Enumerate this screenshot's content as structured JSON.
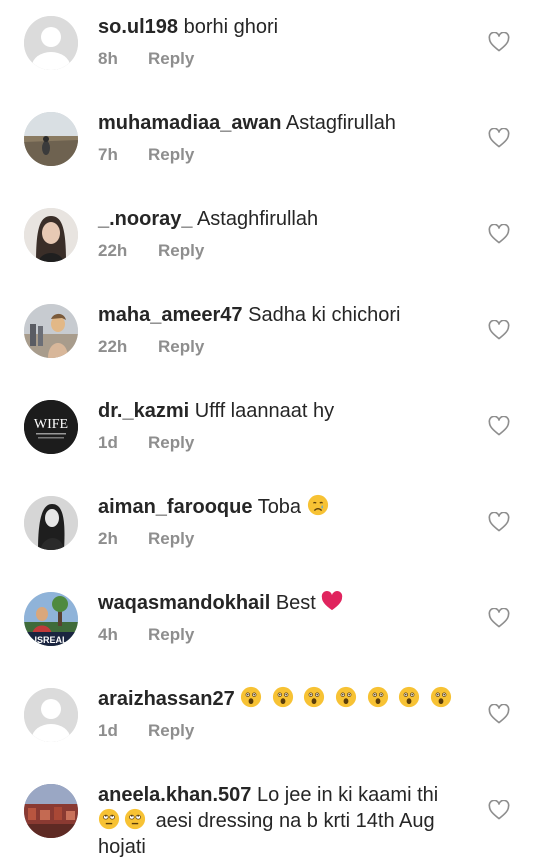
{
  "comments": [
    {
      "username": "so.ul198",
      "text": "borhi ghori",
      "time": "8h",
      "reply": "Reply"
    },
    {
      "username": "muhamadiaa_awan",
      "text": "Astagfirullah",
      "time": "7h",
      "reply": "Reply"
    },
    {
      "username": "_.nooray_",
      "text": "Astaghfirullah",
      "time": "22h",
      "reply": "Reply"
    },
    {
      "username": "maha_ameer47",
      "text": "Sadha ki chichori",
      "time": "22h",
      "reply": "Reply"
    },
    {
      "username": "dr._kazmi",
      "text": "Ufff laannaat hy",
      "time": "1d",
      "reply": "Reply",
      "avatar_text": "WIFE"
    },
    {
      "username": "aiman_farooque",
      "text": "Toba",
      "time": "2h",
      "reply": "Reply"
    },
    {
      "username": "waqasmandokhail",
      "text": "Best",
      "time": "4h",
      "reply": "Reply",
      "avatar_text": "ISREAL"
    },
    {
      "username": "araizhassan27",
      "text": "",
      "time": "1d",
      "reply": "Reply"
    },
    {
      "username": "aneela.khan.507",
      "text": "Lo jee in ki kaami thi",
      "text2": "aesi dressing na b krti 14th Aug",
      "text3": "hojati",
      "time": "",
      "reply": ""
    }
  ],
  "icons": {
    "heart": "heart-outline-icon",
    "sad_emoji": "crying-face-emoji",
    "red_heart": "red-heart-emoji",
    "astonished": "astonished-face-emoji",
    "eye_roll": "eye-roll-emoji"
  },
  "colors": {
    "text": "#262626",
    "meta": "#8e8e8e",
    "placeholder_avatar": "#dbdbdb",
    "emoji_yellow": "#f7c234",
    "heart_red": "#e0245e"
  }
}
